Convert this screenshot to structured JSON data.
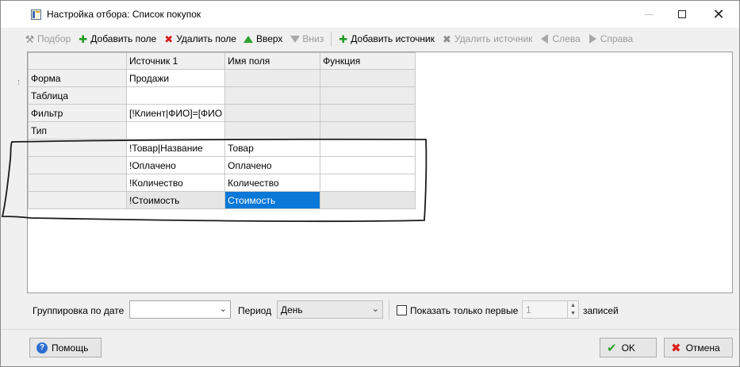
{
  "window": {
    "title": "Настройка отбора: Список покупок",
    "controls": {
      "minimize": "—",
      "maximize": "☐",
      "close": "✕"
    }
  },
  "toolbar": {
    "items": [
      {
        "label": "Подбор",
        "icon": "wand-icon",
        "enabled": false
      },
      {
        "label": "Добавить поле",
        "icon": "plus-icon",
        "enabled": true
      },
      {
        "label": "Удалить поле",
        "icon": "x-icon",
        "enabled": true
      },
      {
        "label": "Вверх",
        "icon": "arrow-up-icon",
        "enabled": true
      },
      {
        "label": "Вниз",
        "icon": "arrow-down-icon",
        "enabled": false
      },
      {
        "label": "Добавить источник",
        "icon": "plus-icon",
        "enabled": true
      },
      {
        "label": "Удалить источник",
        "icon": "x-icon",
        "enabled": false
      },
      {
        "label": "Слева",
        "icon": "arrow-left-icon",
        "enabled": false
      },
      {
        "label": "Справа",
        "icon": "arrow-right-icon",
        "enabled": false
      }
    ]
  },
  "grid": {
    "headers": [
      "",
      "Источник 1",
      "Имя поля",
      "Функция"
    ],
    "rows": [
      {
        "label": "Форма",
        "source": "Продажи",
        "field": "",
        "func": ""
      },
      {
        "label": "Таблица",
        "source": "",
        "field": "",
        "func": ""
      },
      {
        "label": "Фильтр",
        "source": "[!Клиент|ФИО]=[ФИО",
        "field": "",
        "func": ""
      },
      {
        "label": "Тип",
        "source": "",
        "field": "",
        "func": ""
      },
      {
        "label": "",
        "source": "!Товар|Название",
        "field": "Товар",
        "func": ""
      },
      {
        "label": "",
        "source": "!Оплачено",
        "field": "Оплачено",
        "func": ""
      },
      {
        "label": "",
        "source": "!Количество",
        "field": "Количество",
        "func": ""
      },
      {
        "label": "",
        "source": "!Стоимость",
        "field": "Стоимость",
        "func": ""
      }
    ],
    "selected_cell": "Стоимость"
  },
  "bottom": {
    "group_by_date_label": "Группировка по дате",
    "group_by_date_value": "",
    "period_label": "Период",
    "period_value": "День",
    "show_first_label": "Показать только первые",
    "show_first_checked": false,
    "show_first_value": "1",
    "records_label": "записей"
  },
  "footer": {
    "help_label": "Помощь",
    "ok_label": "OK",
    "cancel_label": "Отмена"
  },
  "colors": {
    "selection": "#0a78d7",
    "accent_green": "#2ea22e",
    "accent_red": "#d81e1e",
    "help_blue": "#2f6fd1"
  }
}
